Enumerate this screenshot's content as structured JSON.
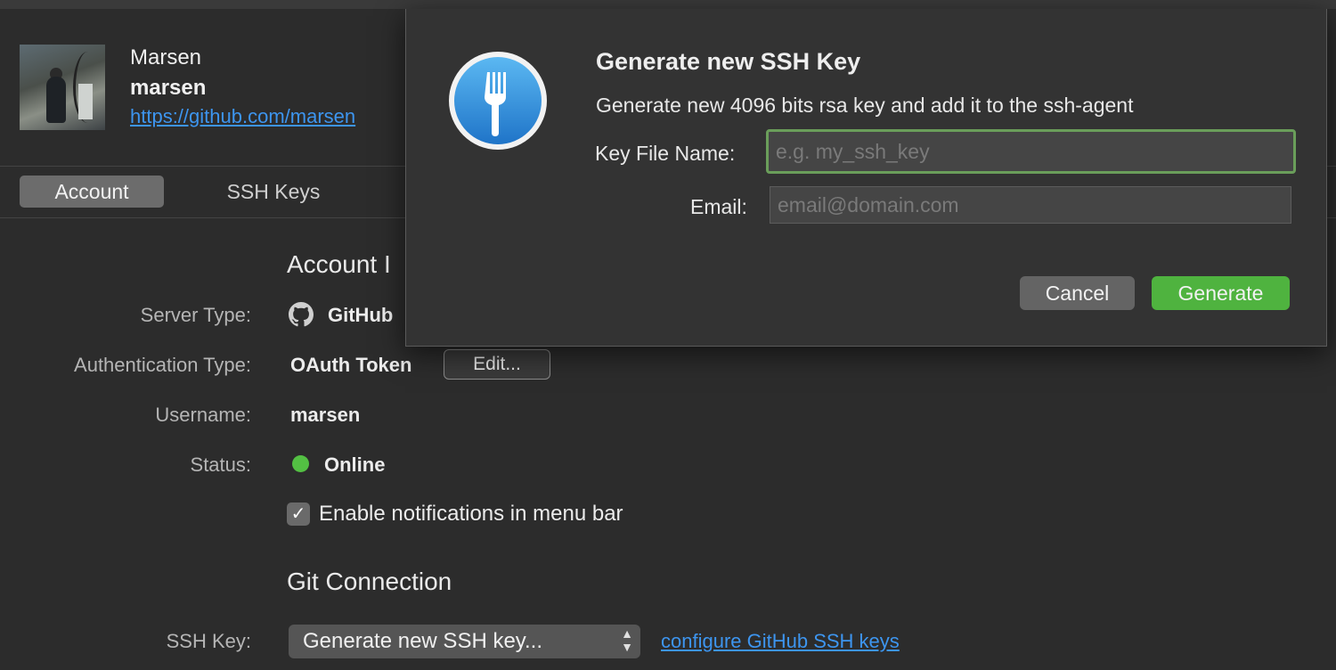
{
  "profile": {
    "display_name": "Marsen",
    "login": "marsen",
    "url": "https://github.com/marsen"
  },
  "tabs": [
    {
      "label": "Account",
      "active": true
    },
    {
      "label": "SSH Keys",
      "active": false
    }
  ],
  "account_info": {
    "section_title": "Account I",
    "server_type_label": "Server Type:",
    "server_type_value": "GitHub",
    "auth_type_label": "Authentication Type:",
    "auth_type_value": "OAuth Token",
    "edit_label": "Edit...",
    "username_label": "Username:",
    "username_value": "marsen",
    "status_label": "Status:",
    "status_value": "Online",
    "status_color": "#53c043",
    "notifications_label": "Enable notifications in menu bar",
    "notifications_checked": true
  },
  "git_connection": {
    "section_title": "Git Connection",
    "ssh_key_label": "SSH Key:",
    "ssh_key_selected": "Generate new SSH key...",
    "configure_link": "configure GitHub SSH keys"
  },
  "dialog": {
    "icon": "fork-icon",
    "title": "Generate new SSH Key",
    "message": "Generate new 4096 bits rsa key and add it to the ssh-agent",
    "key_file_label": "Key File Name:",
    "key_file_placeholder": "e.g. my_ssh_key",
    "key_file_value": "",
    "email_label": "Email:",
    "email_placeholder": "email@domain.com",
    "email_value": "",
    "cancel_label": "Cancel",
    "generate_label": "Generate",
    "accent_color": "#4fb33f"
  }
}
